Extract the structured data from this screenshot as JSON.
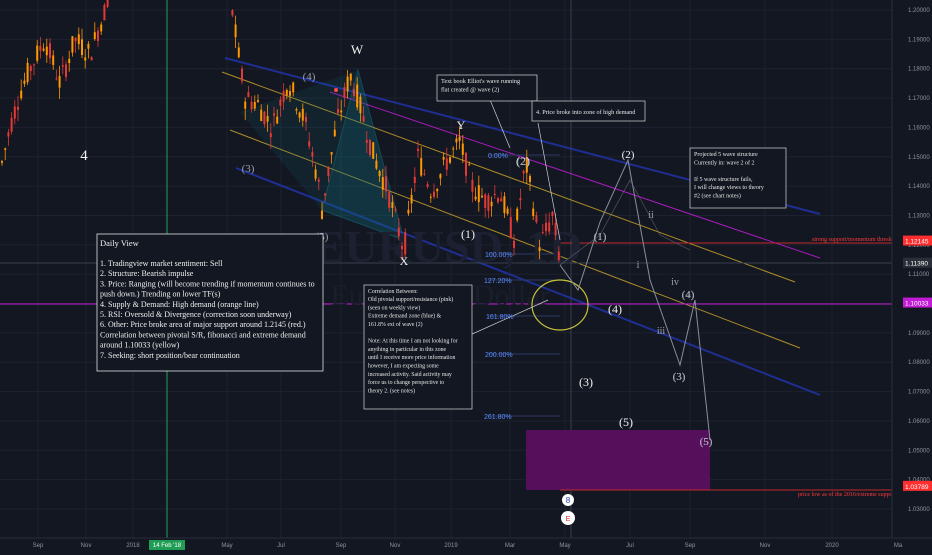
{
  "chart_data": {
    "type": "candlestick",
    "symbol_watermark": "EURUSD, 1D",
    "watermark_sub": "Euro / U.S. Dollar",
    "y_axis": {
      "range": [
        1.027,
        1.207
      ],
      "ticks": [
        "1.20000",
        "1.19000",
        "1.18000",
        "1.17000",
        "1.16000",
        "1.15000",
        "1.14000",
        "1.13000",
        "1.12000",
        "1.11000",
        "1.10000",
        "1.09000",
        "1.08000",
        "1.07000",
        "1.06000",
        "1.05000",
        "1.04000",
        "1.03000"
      ],
      "tick_values": [
        1.2,
        1.19,
        1.18,
        1.17,
        1.16,
        1.15,
        1.14,
        1.13,
        1.12,
        1.11,
        1.1,
        1.09,
        1.08,
        1.07,
        1.06,
        1.05,
        1.04,
        1.03
      ]
    },
    "x_axis": {
      "labels": [
        "Sep",
        "Nov",
        "2018",
        "14 Feb '18",
        "May",
        "Jul",
        "Sep",
        "Nov",
        "2019",
        "Mar",
        "May",
        "Jul",
        "Sep",
        "Nov",
        "2020",
        "Ma"
      ]
    },
    "price_badges": [
      {
        "label": "1.12145",
        "color": "#ff2e2e",
        "value": 1.12145
      },
      {
        "label": "1.11390",
        "color": "#2a2e39",
        "value": 1.1139
      },
      {
        "label": "1.10033",
        "color": "#c21bd6",
        "value": 1.10033
      },
      {
        "label": "1.03789",
        "color": "#ff2e2e",
        "value": 1.03789
      }
    ],
    "levels": [
      {
        "value": 1.12145,
        "color": "#e02a2a",
        "label": "strong support/momentum threshold"
      },
      {
        "value": 1.10033,
        "color": "#c21bd6",
        "label": ""
      },
      {
        "value": 1.03789,
        "color": "#e02a2a",
        "label": "price low as of the 2016/extreme support"
      }
    ],
    "fib_labels": [
      "0.00%",
      "100.00%",
      "127.20%",
      "161.80%",
      "200.00%",
      "261.80%"
    ],
    "wave_labels": {
      "white": [
        "4",
        "W",
        "Y",
        "X",
        "(1)",
        "(2)",
        "(3)",
        "(4)",
        "(5)",
        "(4)",
        "(3)",
        "(5)",
        "(1)",
        "(2)"
      ],
      "gray": [
        "(3)",
        "(4)",
        "(5)",
        "(2)",
        "(1)",
        "i",
        "ii",
        "iii",
        "iv",
        "(3)",
        "(4)",
        "(5)"
      ]
    },
    "colors": {
      "up": "#ff9800",
      "down": "#e53935",
      "channel_blue": "#2133a6",
      "channel_orange": "#c9a227",
      "channel_pink": "#c21bd6",
      "fib": "#4a7dff",
      "zone": "#5a0f5e",
      "ellipse": "#c9c238"
    }
  },
  "daily_view": {
    "title": "Daily View",
    "lines": [
      "1.  Tradingview market sentiment: Sell",
      "2.  Structure: Bearish impulse",
      "3.  Price: Ranging (will become trending if momentum continues to",
      "     push down.) Trending on lower TF(s)",
      "4.  Supply & Demand: High demand (orange line)",
      "5.  RSI: Oversold & Divergence (correction soon underway)",
      "6.  Other: Price broke area of major support around 1.2145 (red.)",
      "     Correlation between pivotal S/R, fibonacci and extreme demand",
      "     around 1.10033 (yellow)",
      "7.  Seeking: short position/bear continuation"
    ]
  },
  "notes": {
    "textbook": [
      "Text book Elliot's wave running",
      "flat created @ wave (2)"
    ],
    "broke": "4.  Price broke into zone of high demand",
    "projected": [
      "Projected 5 wave structure",
      "Currently in: wave 2 of 2",
      "",
      "If 5 wave structure fails,",
      "I will change views to theory",
      "#2 (see chart notes)"
    ],
    "correlation": [
      "Correlation Between:",
      "   Old pivotal support/resistance (pink)",
      "      (seen on weekly view)",
      "   Extreme demand zone (blue) &",
      "   161.8% ext of wave (2)",
      "",
      "   Note: At this time I am not looking for",
      "   anything in particular in this zone",
      "   until I receive more price information",
      "   however, I am expecting some",
      "   increased activity. Said activity may",
      "   force us to change perspective to",
      "   theory 2. (see notes)"
    ]
  },
  "bottom_badges": [
    "8",
    "E"
  ]
}
